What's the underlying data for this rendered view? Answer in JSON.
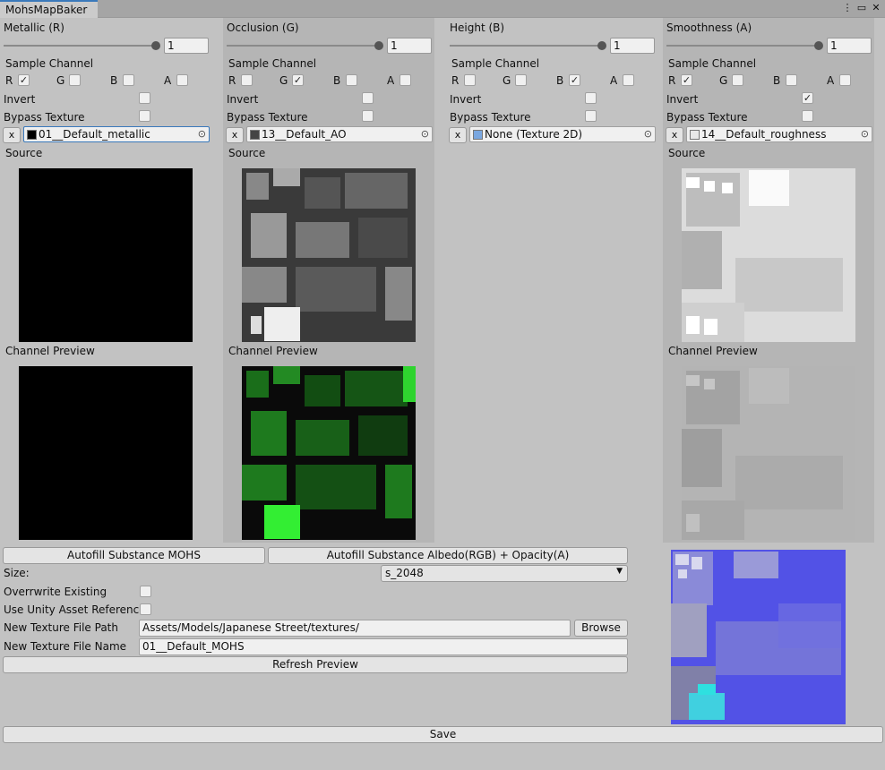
{
  "window": {
    "tab_title": "MohsMapBaker",
    "icons": [
      "more-vert-icon",
      "maximize-icon",
      "close-icon"
    ]
  },
  "columns": [
    {
      "title": "Metallic (R)",
      "slider_value": "1",
      "sample_channel_label": "Sample Channel",
      "channels": [
        "R",
        "G",
        "B",
        "A"
      ],
      "checked": [
        true,
        false,
        false,
        false
      ],
      "invert_label": "Invert",
      "invert": false,
      "bypass_label": "Bypass Texture",
      "bypass": false,
      "x_label": "x",
      "texture_name": "01__Default_metallic",
      "source_label": "Source",
      "preview_label": "Channel Preview",
      "has_images": true
    },
    {
      "title": "Occlusion (G)",
      "slider_value": "1",
      "sample_channel_label": "Sample Channel",
      "channels": [
        "R",
        "G",
        "B",
        "A"
      ],
      "checked": [
        false,
        true,
        false,
        false
      ],
      "invert_label": "Invert",
      "invert": false,
      "bypass_label": "Bypass Texture",
      "bypass": false,
      "x_label": "x",
      "texture_name": "13__Default_AO",
      "source_label": "Source",
      "preview_label": "Channel Preview",
      "has_images": true
    },
    {
      "title": "Height (B)",
      "slider_value": "1",
      "sample_channel_label": "Sample Channel",
      "channels": [
        "R",
        "G",
        "B",
        "A"
      ],
      "checked": [
        false,
        false,
        true,
        false
      ],
      "invert_label": "Invert",
      "invert": false,
      "bypass_label": "Bypass Texture",
      "bypass": false,
      "x_label": "x",
      "texture_name": "None (Texture 2D)",
      "source_label": "",
      "preview_label": "",
      "has_images": false
    },
    {
      "title": "Smoothness (A)",
      "slider_value": "1",
      "sample_channel_label": "Sample Channel",
      "channels": [
        "R",
        "G",
        "B",
        "A"
      ],
      "checked": [
        true,
        false,
        false,
        false
      ],
      "invert_label": "Invert",
      "invert": true,
      "bypass_label": "Bypass Texture",
      "bypass": false,
      "x_label": "x",
      "texture_name": "14__Default_roughness",
      "source_label": "Source",
      "preview_label": "Channel Preview",
      "has_images": true
    }
  ],
  "bottom": {
    "autofill_mohs": "Autofill Substance MOHS",
    "autofill_albedo": "Autofill Substance Albedo(RGB) + Opacity(A)",
    "size_label": "Size:",
    "size_value": "s_2048",
    "overwrite_label": "Overrwrite Existing",
    "overwrite": false,
    "unity_ref_label": "Use Unity Asset Reference",
    "unity_ref": false,
    "path_label": "New Texture File Path",
    "path_value": "Assets/Models/Japanese Street/textures/",
    "browse": "Browse",
    "name_label": "New Texture File Name",
    "name_value": "01__Default_MOHS",
    "refresh": "Refresh Preview",
    "save": "Save"
  },
  "colors": {
    "accent": "#3a79bb",
    "occlusion_preview": "#22e622",
    "final_preview": "#5050e8"
  }
}
